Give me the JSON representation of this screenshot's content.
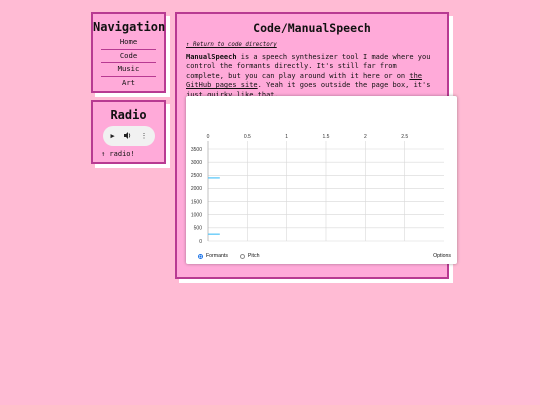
{
  "nav": {
    "title": "Navigation",
    "items": [
      "Home",
      "Code",
      "Music",
      "Art"
    ]
  },
  "radio": {
    "title": "Radio",
    "link": "↑ radio!",
    "controls": [
      "play-icon",
      "volume-icon",
      "more-icon"
    ]
  },
  "main": {
    "title": "Code/ManualSpeech",
    "back_link": "↑ Return to code directory",
    "desc_bold": "ManualSpeech",
    "desc_1": " is a speech synthesizer tool I made where you control the formants directly. It's still far from complete, but you can play around with it here or on ",
    "desc_link": "the GitHub pages site",
    "desc_2": ". Yeah it goes outside the page box, it's just quirky like that."
  },
  "widget": {
    "mode_formants": "Formants",
    "mode_pitch": "Pitch",
    "selected_mode": "Formants",
    "options_label": "Options"
  },
  "chart_data": {
    "type": "line",
    "x_ticks": [
      "0",
      "0.5",
      "1",
      "1.5",
      "2",
      "2.5"
    ],
    "y_ticks": [
      "0",
      "500",
      "1000",
      "1500",
      "2000",
      "2500",
      "3000",
      "3500"
    ],
    "xlim": [
      0,
      3.0
    ],
    "ylim": [
      0,
      3500
    ],
    "grid": true,
    "line_color": "#4fc3f7",
    "series": [
      {
        "values": [
          [
            0,
            2400
          ],
          [
            0.15,
            2400
          ]
        ]
      },
      {
        "values": [
          [
            0,
            260
          ],
          [
            0.15,
            260
          ]
        ]
      }
    ]
  }
}
